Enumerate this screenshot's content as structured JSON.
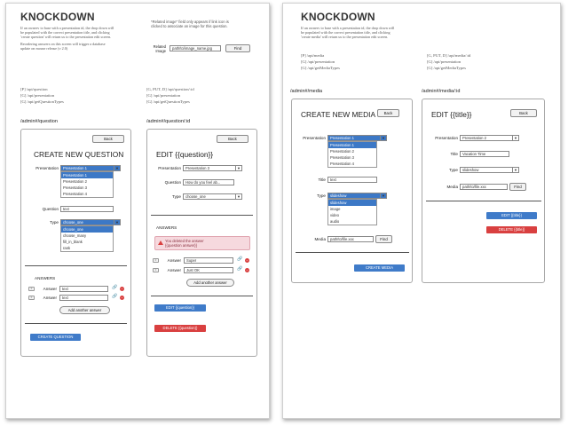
{
  "page1": {
    "title": "KNOCKDOWN",
    "intro": [
      "If an ownerv to base with a presentation id, the drop down will",
      "be populated with the correct presentation title, and clicking",
      "'create question' will return us to the presentation edit screen."
    ],
    "note": [
      "Reordering answers on this screen will trigger a database",
      "update on mouse release (v 2.0)"
    ],
    "related_note": [
      "*Related image\" field only appears if link icon is",
      "clicked to associate an image for this question."
    ],
    "related_image": {
      "label_1": "Related",
      "label_2": "Image",
      "value": "path/to/image_name.jpg",
      "find": "Find"
    },
    "routes_left": [
      "[P] /api/question",
      "[G] /api/presentation",
      "[G] /api/getQuestionTypes"
    ],
    "routes_right": [
      "[G, PUT, D] /api/question/:id",
      "[G] /api/presentation",
      "[G] /api/getQuestionTypes"
    ],
    "new_q": {
      "route": "/admin#/question",
      "back": "Back",
      "heading": "CREATE NEW QUESTION",
      "presentation_label": "Presentation",
      "presentation_selected": "Presentation 1",
      "presentation_options": [
        "Presentation 1",
        "Presentation 2",
        "Presentation 3",
        "Presentation 4"
      ],
      "question_label": "Question",
      "question_value": "text",
      "type_label": "Type",
      "type_selected": "choose_one",
      "type_options": [
        "choose_one",
        "choose_many",
        "fill_in_blank",
        "rank"
      ],
      "answers_label": "ANSWERS",
      "answer_label": "Answer",
      "answers": [
        "text",
        "text"
      ],
      "add_answer": "Add another answer",
      "create": "CREATE QUESTION"
    },
    "edit_q": {
      "route": "/admin#/question/:id",
      "back": "Back",
      "heading": "EDIT {{question}}",
      "presentation_label": "Presentation",
      "presentation_value": "Presentation 3",
      "question_label": "Question",
      "question_value": "How do you feel ab...",
      "type_label": "Type",
      "type_value": "choose_one",
      "answers_label": "ANSWERS",
      "alert_1": "You deleted the answer",
      "alert_2": "{{question answer}}",
      "answer_label": "Answer",
      "answers": [
        "Super",
        "Just OK"
      ],
      "add_answer": "Add another answer",
      "edit": "EDIT {{question}}",
      "delete": "DELETE {{question}}"
    }
  },
  "page2": {
    "title": "KNOCKDOWN",
    "intro": [
      "If an ownerv to base with a presentation id, the drop down will",
      "be populated with the correct presentation title, and clicking",
      "'create media' will return us to the presentation edit screen."
    ],
    "routes_left": [
      "[P] /api/media",
      "[G] /api/presentation",
      "[G] /api/getMediaTypes"
    ],
    "routes_right": [
      "[G, PUT, D] /api/media/:id",
      "[G] /api/presentation",
      "[G] /api/getMediaTypes"
    ],
    "new_m": {
      "route": "/admin#/media",
      "back": "Back",
      "heading": "CREATE NEW MEDIA",
      "presentation_label": "Presentation",
      "presentation_selected": "Presentation 1",
      "presentation_options": [
        "Presentation 1",
        "Presentation 2",
        "Presentation 3",
        "Presentation 4"
      ],
      "title_label": "Title",
      "title_value": "text",
      "type_label": "Type",
      "type_selected": "slideshow",
      "type_options": [
        "slideshow",
        "image",
        "video",
        "audio"
      ],
      "media_label": "Media",
      "media_value": "path/to/file.xxx",
      "find": "Find",
      "create": "CREATE MEDIA"
    },
    "edit_m": {
      "route": "/admin#/media/:id",
      "back": "Back",
      "heading": "EDIT {{title}}",
      "presentation_label": "Presentation",
      "presentation_value": "Presentation 2",
      "title_label": "Title",
      "title_value": "Vacation Time",
      "type_label": "Type",
      "type_value": "slideshow",
      "media_label": "Media",
      "media_value": "path/to/file.xxx",
      "find": "Find",
      "edit": "EDIT {{title}}",
      "delete": "DELETE {{title}}"
    }
  },
  "colors": {
    "primary": "#3f7bc9",
    "danger": "#d94040",
    "alert_bg": "#f6d9de"
  },
  "icons": [
    "link-icon",
    "delete-icon",
    "drag-handle-icon",
    "warning-icon",
    "dropdown-arrow-icon"
  ]
}
